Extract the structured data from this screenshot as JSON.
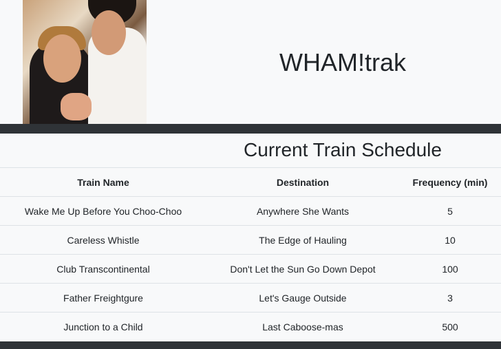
{
  "header": {
    "brand": "WHAM!trak"
  },
  "schedule": {
    "title": "Current Train Schedule",
    "columns": [
      "Train Name",
      "Destination",
      "Frequency (min)"
    ],
    "rows": [
      [
        "Wake Me Up Before You Choo-Choo",
        "Anywhere She Wants",
        "5"
      ],
      [
        "Careless Whistle",
        "The Edge of Hauling",
        "10"
      ],
      [
        "Club Transcontinental",
        "Don't Let the Sun Go Down Depot",
        "100"
      ],
      [
        "Father Freightgure",
        "Let's Gauge Outside",
        "3"
      ],
      [
        "Junction to a Child",
        "Last Caboose-mas",
        "500"
      ]
    ]
  }
}
